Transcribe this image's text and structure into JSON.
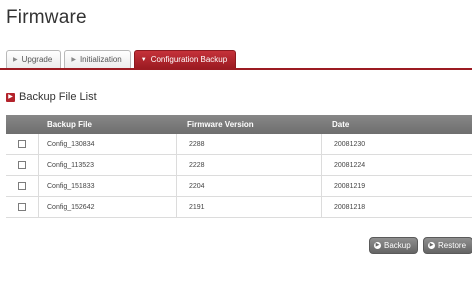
{
  "page": {
    "title": "Firmware"
  },
  "tabs": [
    {
      "label": "Upgrade",
      "active": false
    },
    {
      "label": "Initialization",
      "active": false
    },
    {
      "label": "Configuration Backup",
      "active": true
    }
  ],
  "section": {
    "title": "Backup File List"
  },
  "table": {
    "headers": {
      "file": "Backup File",
      "firmware": "Firmware Version",
      "date": "Date"
    },
    "rows": [
      {
        "file": "Config_130834",
        "firmware": "2288",
        "date": "20081230",
        "checked": false
      },
      {
        "file": "Config_113523",
        "firmware": "2228",
        "date": "20081224",
        "checked": false
      },
      {
        "file": "Config_151833",
        "firmware": "2204",
        "date": "20081219",
        "checked": false
      },
      {
        "file": "Config_152642",
        "firmware": "2191",
        "date": "20081218",
        "checked": false
      }
    ]
  },
  "buttons": {
    "backup": "Backup",
    "restore": "Restore"
  },
  "colors": {
    "accent": "#b3232b",
    "header_bg": "#7a7a7a",
    "button_bg": "#7a7a7a"
  }
}
